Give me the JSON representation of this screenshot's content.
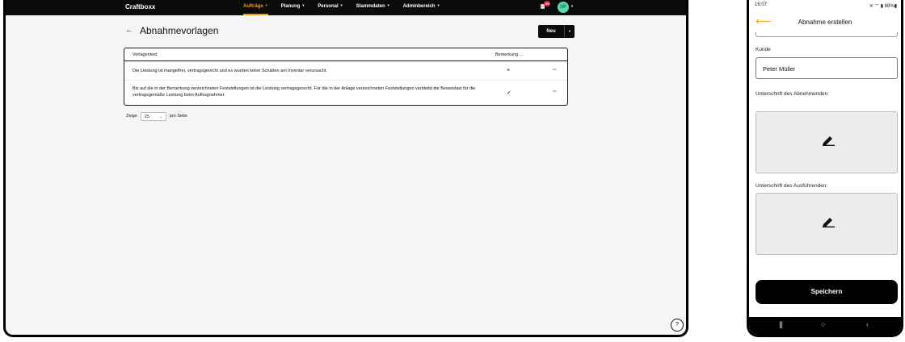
{
  "desktop": {
    "brand": "Craftboxx",
    "nav": [
      {
        "label": "Aufträge",
        "active": true
      },
      {
        "label": "Planung",
        "active": false
      },
      {
        "label": "Personal",
        "active": false
      },
      {
        "label": "Stammdaten",
        "active": false
      },
      {
        "label": "Adminbereich",
        "active": false
      }
    ],
    "notification_count": "99",
    "avatar_initials": "SP",
    "page_title": "Abnahmevorlagen",
    "new_button_label": "Neu",
    "table": {
      "headers": {
        "text": "Vorlagentext",
        "remark": "Bemerkung ..."
      },
      "rows": [
        {
          "text": "Die Leistung ist mangelfrei, vertragsgerecht und es wurden keine Schäden am Inventar verursacht.",
          "remark_icon": "×",
          "menu": "···"
        },
        {
          "text": "Bis auf die in der Bemerkung verzeichneten Feststellungen ist die Leistung vertragsgerecht. Für die in der Anlage verzeichneten Feststellungen verbleibt die Beweislast für die vertragsgemäße Leistung beim Auftragnehmer.",
          "remark_icon": "✓",
          "menu": "···"
        }
      ]
    },
    "pager": {
      "prefix": "Zeige",
      "value": "25",
      "suffix": "pro Seite"
    },
    "help_label": "?"
  },
  "phone": {
    "time": "16:07",
    "status_icons": "✕ ⌔ ▮ 68%▮",
    "title": "Abnahme erstellen",
    "customer_label": "Kunde",
    "customer_value": "Peter Müller",
    "signature_receiver_label": "Unterschrift des Abnehmenden:",
    "signature_executor_label": "Unterschrift des Ausführenden:",
    "save_label": "Speichern",
    "nav_recent": "|||",
    "nav_home": "○",
    "nav_back": "‹"
  },
  "colors": {
    "accent": "#f39c1e",
    "topbar": "#0b0b0b",
    "badge": "#e5243b",
    "avatar": "#5dd5b0"
  }
}
